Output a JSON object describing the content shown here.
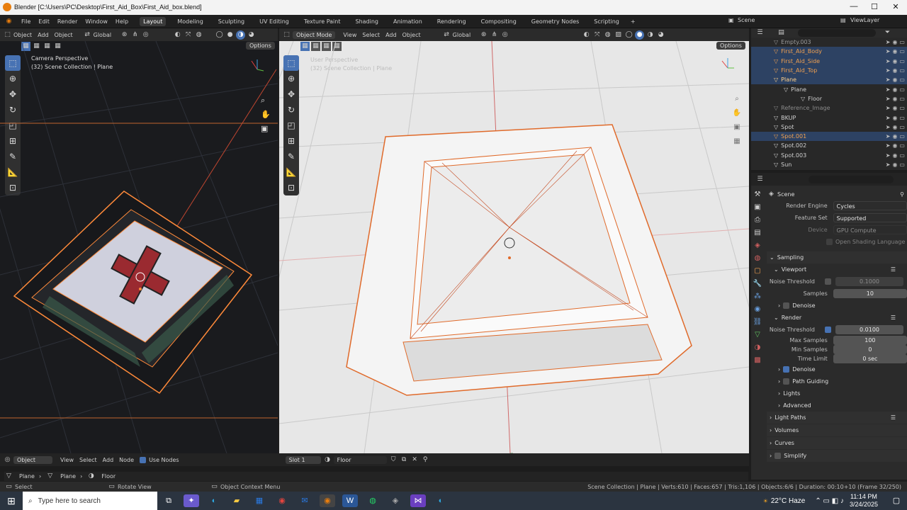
{
  "window": {
    "title": "Blender [C:\\Users\\PC\\Desktop\\First_Aid_Box\\First_Aid_box.blend]",
    "min": "—",
    "max": "☐",
    "close": "✕"
  },
  "menu": {
    "items": [
      "File",
      "Edit",
      "Render",
      "Window",
      "Help"
    ],
    "workspaces": [
      "Layout",
      "Modeling",
      "Sculpting",
      "UV Editing",
      "Texture Paint",
      "Shading",
      "Animation",
      "Rendering",
      "Compositing",
      "Geometry Nodes",
      "Scripting"
    ],
    "active_workspace": "Layout",
    "scene": "Scene",
    "viewlayer": "ViewLayer"
  },
  "left_viewport": {
    "menus": [
      "Object",
      "Add",
      "Object"
    ],
    "orientation": "Global",
    "options": "Options",
    "overlay_title": "Camera Perspective",
    "overlay_sub": "(32) Scene Collection | Plane"
  },
  "main_viewport": {
    "mode": "Object Mode",
    "menus": [
      "View",
      "Select",
      "Add",
      "Object"
    ],
    "orientation": "Global",
    "options": "Options",
    "overlay_title": "User Perspective",
    "overlay_sub": "(32) Scene Collection | Plane"
  },
  "shader_editor": {
    "editor": "Object",
    "menus": [
      "View",
      "Select",
      "Add",
      "Node"
    ],
    "use_nodes": "Use Nodes",
    "slot": "Slot 1",
    "material": "Floor"
  },
  "breadcrumb": [
    "Plane",
    "Plane",
    "Floor"
  ],
  "outliner": {
    "rows": [
      {
        "name": "Empty.003",
        "cls": "",
        "indent": 28,
        "color": "#9a9a9a"
      },
      {
        "name": "First_Aid_Body",
        "cls": "sel",
        "indent": 28,
        "color": "#f0a050"
      },
      {
        "name": "First_Aid_Side",
        "cls": "sel",
        "indent": 28,
        "color": "#f0a050"
      },
      {
        "name": "First_Aid_Top",
        "cls": "sel",
        "indent": 28,
        "color": "#f0a050"
      },
      {
        "name": "Plane",
        "cls": "sel",
        "indent": 28,
        "color": "#ffd08a"
      },
      {
        "name": "Plane",
        "cls": "",
        "indent": 42,
        "color": "#cfcfcf"
      },
      {
        "name": "Floor",
        "cls": "",
        "indent": 66,
        "color": "#cfcfcf"
      },
      {
        "name": "Reference_Image",
        "cls": "",
        "indent": 28,
        "color": "#8a8a8a"
      },
      {
        "name": "BKUP",
        "cls": "",
        "indent": 28,
        "color": "#cfcfcf"
      },
      {
        "name": "Spot",
        "cls": "",
        "indent": 28,
        "color": "#cfcfcf"
      },
      {
        "name": "Spot.001",
        "cls": "sel",
        "indent": 28,
        "color": "#f0a050"
      },
      {
        "name": "Spot.002",
        "cls": "",
        "indent": 28,
        "color": "#cfcfcf"
      },
      {
        "name": "Spot.003",
        "cls": "",
        "indent": 28,
        "color": "#cfcfcf"
      },
      {
        "name": "Sun",
        "cls": "",
        "indent": 28,
        "color": "#cfcfcf"
      }
    ]
  },
  "properties": {
    "context": "Scene",
    "render_engine_label": "Render Engine",
    "render_engine": "Cycles",
    "feature_set_label": "Feature Set",
    "feature_set": "Supported",
    "device_label": "Device",
    "device": "GPU Compute",
    "osl": "Open Shading Language",
    "sampling": "Sampling",
    "viewport": "Viewport",
    "noise_threshold_label": "Noise Threshold",
    "vp_noise": "0.1000",
    "samples_label": "Samples",
    "vp_samples": "10",
    "denoise": "Denoise",
    "render": "Render",
    "r_noise": "0.0100",
    "max_samples_label": "Max Samples",
    "max_samples": "100",
    "min_samples_label": "Min Samples",
    "min_samples": "0",
    "time_limit_label": "Time Limit",
    "time_limit": "0 sec",
    "path_guiding": "Path Guiding",
    "lights": "Lights",
    "advanced": "Advanced",
    "light_paths": "Light Paths",
    "volumes": "Volumes",
    "curves": "Curves",
    "simplify": "Simplify"
  },
  "status": {
    "select": "Select",
    "rotate": "Rotate View",
    "context": "Object Context Menu",
    "stats": "Scene Collection | Plane | Verts:610 | Faces:657 | Tris:1,106 | Objects:6/6 | Duration: 00:10+10 (Frame 32/250)"
  },
  "taskbar": {
    "search": "Type here to search",
    "weather": "22°C  Haze",
    "time": "11:14 PM",
    "date": "3/24/2025"
  },
  "colors": {
    "accent": "#4772b3",
    "select_orange": "#ff8a3a",
    "bg": "#1d1d1d"
  }
}
